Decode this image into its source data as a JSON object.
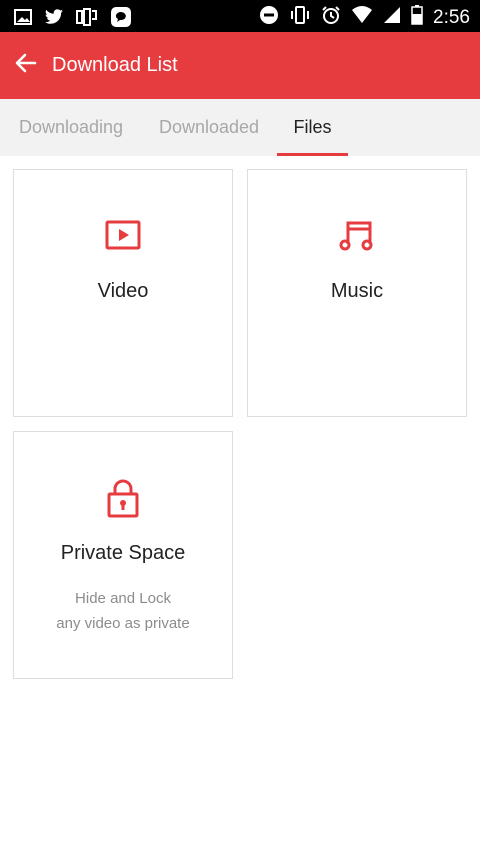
{
  "status_bar": {
    "time": "2:56",
    "left_icons": [
      "image-icon",
      "twitter-icon",
      "app-icon",
      "chat-icon"
    ],
    "right_icons": [
      "dnd-icon",
      "vibrate-icon",
      "alarm-icon",
      "wifi-icon",
      "signal-icon",
      "battery-icon"
    ]
  },
  "app_bar": {
    "title": "Download List",
    "back_icon": "arrow-left-icon",
    "background": "#e63c40"
  },
  "tabs": [
    {
      "label": "Downloading",
      "active": false
    },
    {
      "label": "Downloaded",
      "active": false
    },
    {
      "label": "Files",
      "active": true
    }
  ],
  "cards": {
    "video": {
      "title": "Video",
      "icon": "video-play-icon"
    },
    "music": {
      "title": "Music",
      "icon": "music-note-icon"
    },
    "private": {
      "title": "Private Space",
      "icon": "lock-icon",
      "desc_line1": "Hide and Lock",
      "desc_line2": "any video as private"
    }
  },
  "colors": {
    "accent": "#e63c40",
    "tab_inactive": "#a8a8a8",
    "tab_bar_bg": "#f2f2f2",
    "card_border": "#dddddd"
  }
}
